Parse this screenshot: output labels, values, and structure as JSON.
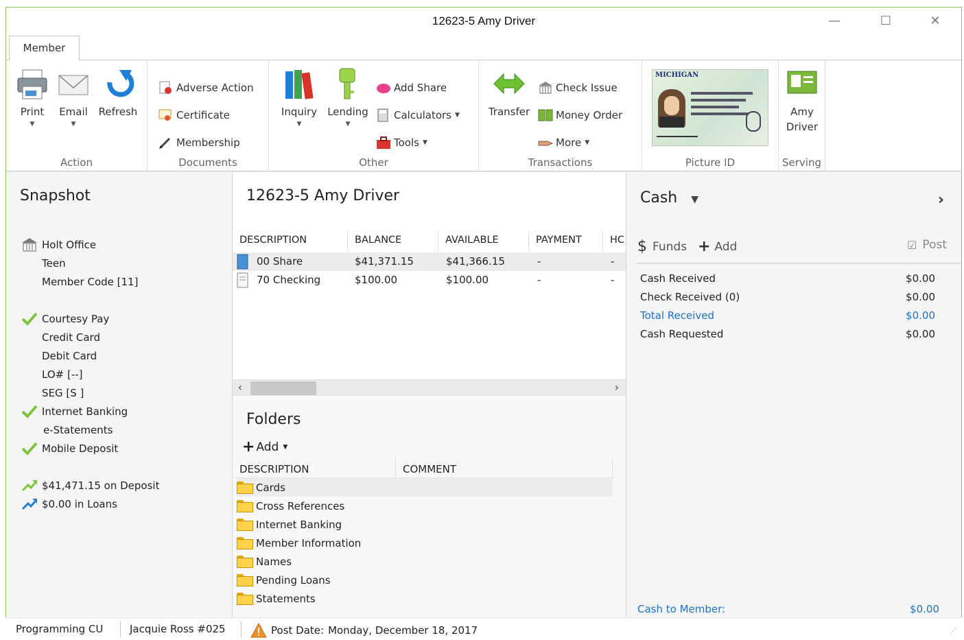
{
  "window": {
    "title": "12623-5 Amy Driver"
  },
  "tabs": [
    {
      "label": "Member"
    }
  ],
  "ribbon": {
    "action": {
      "label": "Action",
      "print": "Print",
      "email": "Email",
      "refresh": "Refresh"
    },
    "documents": {
      "label": "Documents",
      "adverse_action": "Adverse Action",
      "certificate": "Certificate",
      "membership": "Membership"
    },
    "other": {
      "label": "Other",
      "inquiry": "Inquiry",
      "lending": "Lending",
      "add_share": "Add Share",
      "calculators": "Calculators",
      "tools": "Tools"
    },
    "transactions": {
      "label": "Transactions",
      "transfer": "Transfer",
      "check_issue": "Check Issue",
      "money_order": "Money Order",
      "more": "More"
    },
    "picture_id": {
      "label": "Picture ID",
      "card_state": "MICHIGAN"
    },
    "serving": {
      "label": "Serving",
      "name_line1": "Amy",
      "name_line2": "Driver"
    }
  },
  "snapshot": {
    "title": "Snapshot",
    "office": "Holt Office",
    "age_group": "Teen",
    "member_code": "Member Code [11]",
    "services": [
      "Courtesy Pay",
      "Credit Card",
      "Debit Card",
      "LO# [--]",
      "SEG [S ]",
      "Internet Banking",
      "e-Statements",
      "Mobile Deposit"
    ],
    "deposits": "$41,471.15 on Deposit",
    "loans": "$0.00 in Loans"
  },
  "accounts": {
    "title": "12623-5 Amy Driver",
    "columns": [
      "DESCRIPTION",
      "BALANCE",
      "AVAILABLE",
      "PAYMENT",
      "HC"
    ],
    "rows": [
      {
        "description": "00 Share",
        "balance": "$41,371.15",
        "available": "$41,366.15",
        "payment": "-",
        "hold": "-"
      },
      {
        "description": "70 Checking",
        "balance": "$100.00",
        "available": "$100.00",
        "payment": "-",
        "hold": "-"
      }
    ]
  },
  "folders": {
    "title": "Folders",
    "add_label": "Add",
    "columns": [
      "DESCRIPTION",
      "COMMENT"
    ],
    "items": [
      "Cards",
      "Cross References",
      "Internet Banking",
      "Member Information",
      "Names",
      "Pending Loans",
      "Statements"
    ]
  },
  "cash": {
    "title": "Cash",
    "funds_label": "Funds",
    "add_label": "Add",
    "post_label": "Post",
    "rows": [
      {
        "label": "Cash Received",
        "value": "$0.00"
      },
      {
        "label": "Check Received (0)",
        "value": "$0.00"
      },
      {
        "label": "Total Received",
        "value": "$0.00"
      },
      {
        "label": "Cash Requested",
        "value": "$0.00"
      }
    ],
    "to_member_label": "Cash to Member:",
    "to_member_value": "$0.00"
  },
  "status": {
    "institution": "Programming CU",
    "teller": "Jacquie Ross #025",
    "post_date_label": "Post Date:",
    "post_date": "Monday, December 18, 2017"
  },
  "colors": {
    "accent_green": "#8cc65c",
    "link_blue": "#1a73c9",
    "check_green": "#7cc43a"
  }
}
